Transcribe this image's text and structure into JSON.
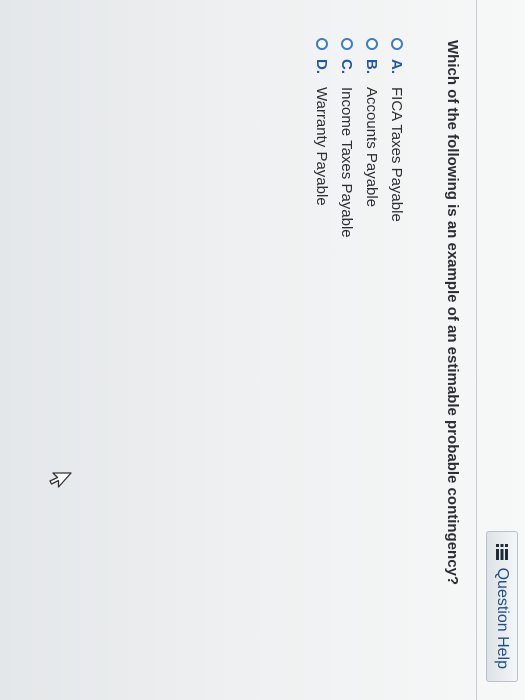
{
  "help": {
    "label": "Question Help",
    "icon": "list-icon"
  },
  "question": {
    "text": "Which of the following is an example of an estimable probable contingency?"
  },
  "options": [
    {
      "letter": "A.",
      "text": "FICA Taxes Payable"
    },
    {
      "letter": "B.",
      "text": "Accounts Payable"
    },
    {
      "letter": "C.",
      "text": "Income Taxes Payable"
    },
    {
      "letter": "D.",
      "text": "Warranty Payable"
    }
  ],
  "colors": {
    "accent": "#3d7ad1",
    "link": "#1f4f8a",
    "text": "#2b2f33"
  },
  "cursor": {
    "icon": "mouse-pointer-icon"
  }
}
